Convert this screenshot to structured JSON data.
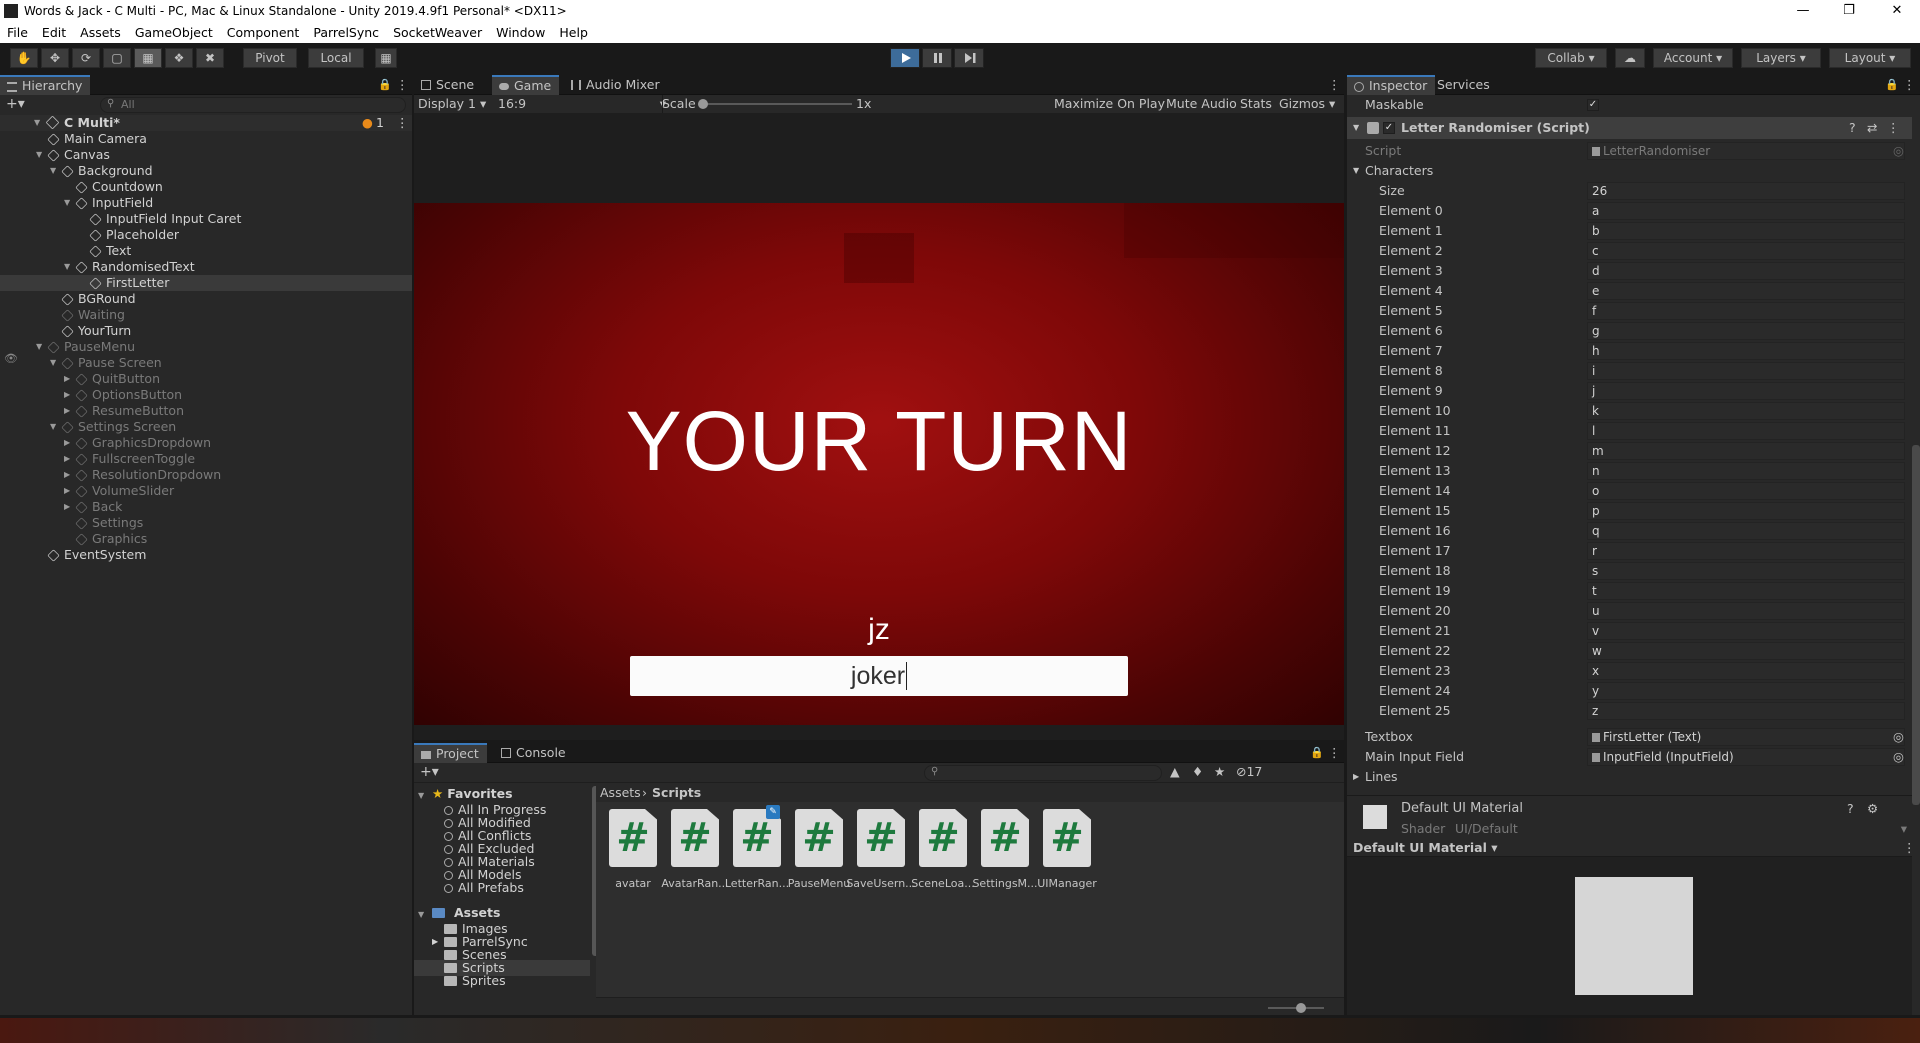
{
  "window": {
    "title": "Words & Jack - C Multi - PC, Mac & Linux Standalone - Unity 2019.4.9f1 Personal* <DX11>"
  },
  "menu": [
    "File",
    "Edit",
    "Assets",
    "GameObject",
    "Component",
    "ParrelSync",
    "SocketWeaver",
    "Window",
    "Help"
  ],
  "toolbar": {
    "pivot": "Pivot",
    "local": "Local",
    "collab": "Collab",
    "account": "Account",
    "layers": "Layers",
    "layout": "Layout"
  },
  "hierarchy": {
    "tab": "Hierarchy",
    "search_placeholder": "All",
    "scene": "C Multi*",
    "scene_count": "1",
    "items": [
      {
        "label": "Main Camera",
        "depth": 1,
        "dim": false,
        "sel": false,
        "arrow": ""
      },
      {
        "label": "Canvas",
        "depth": 1,
        "dim": false,
        "sel": false,
        "arrow": "▼"
      },
      {
        "label": "Background",
        "depth": 2,
        "dim": false,
        "sel": false,
        "arrow": "▼"
      },
      {
        "label": "Countdown",
        "depth": 3,
        "dim": false,
        "sel": false,
        "arrow": ""
      },
      {
        "label": "InputField",
        "depth": 3,
        "dim": false,
        "sel": false,
        "arrow": "▼"
      },
      {
        "label": "InputField Input Caret",
        "depth": 4,
        "dim": false,
        "sel": false,
        "arrow": ""
      },
      {
        "label": "Placeholder",
        "depth": 4,
        "dim": false,
        "sel": false,
        "arrow": ""
      },
      {
        "label": "Text",
        "depth": 4,
        "dim": false,
        "sel": false,
        "arrow": ""
      },
      {
        "label": "RandomisedText",
        "depth": 3,
        "dim": false,
        "sel": false,
        "arrow": "▼"
      },
      {
        "label": "FirstLetter",
        "depth": 4,
        "dim": false,
        "sel": true,
        "arrow": ""
      },
      {
        "label": "BGRound",
        "depth": 2,
        "dim": false,
        "sel": false,
        "arrow": ""
      },
      {
        "label": "Waiting",
        "depth": 2,
        "dim": true,
        "sel": false,
        "arrow": ""
      },
      {
        "label": "YourTurn",
        "depth": 2,
        "dim": false,
        "sel": false,
        "arrow": ""
      },
      {
        "label": "PauseMenu",
        "depth": 1,
        "dim": true,
        "sel": false,
        "arrow": "▼"
      },
      {
        "label": "Pause Screen",
        "depth": 2,
        "dim": true,
        "sel": false,
        "arrow": "▼"
      },
      {
        "label": "QuitButton",
        "depth": 3,
        "dim": true,
        "sel": false,
        "arrow": "▶"
      },
      {
        "label": "OptionsButton",
        "depth": 3,
        "dim": true,
        "sel": false,
        "arrow": "▶"
      },
      {
        "label": "ResumeButton",
        "depth": 3,
        "dim": true,
        "sel": false,
        "arrow": "▶"
      },
      {
        "label": "Settings Screen",
        "depth": 2,
        "dim": true,
        "sel": false,
        "arrow": "▼"
      },
      {
        "label": "GraphicsDropdown",
        "depth": 3,
        "dim": true,
        "sel": false,
        "arrow": "▶"
      },
      {
        "label": "FullscreenToggle",
        "depth": 3,
        "dim": true,
        "sel": false,
        "arrow": "▶"
      },
      {
        "label": "ResolutionDropdown",
        "depth": 3,
        "dim": true,
        "sel": false,
        "arrow": "▶"
      },
      {
        "label": "VolumeSlider",
        "depth": 3,
        "dim": true,
        "sel": false,
        "arrow": "▶"
      },
      {
        "label": "Back",
        "depth": 3,
        "dim": true,
        "sel": false,
        "arrow": "▶"
      },
      {
        "label": "Settings",
        "depth": 3,
        "dim": true,
        "sel": false,
        "arrow": ""
      },
      {
        "label": "Graphics",
        "depth": 3,
        "dim": true,
        "sel": false,
        "arrow": ""
      },
      {
        "label": "EventSystem",
        "depth": 1,
        "dim": false,
        "sel": false,
        "arrow": ""
      }
    ]
  },
  "views": {
    "scene_tab": "Scene",
    "game_tab": "Game",
    "audio_tab": "Audio Mixer",
    "display": "Display 1",
    "aspect": "16:9",
    "scale_label": "Scale",
    "scale_value": "1x",
    "maximize": "Maximize On Play",
    "mute": "Mute Audio",
    "stats": "Stats",
    "gizmos": "Gizmos"
  },
  "game": {
    "heading": "YOUR TURN",
    "letters": "jz",
    "input_value": "joker"
  },
  "project": {
    "tab": "Project",
    "console_tab": "Console",
    "hidden_count": "17",
    "favorites_label": "Favorites",
    "favorites": [
      "All In Progress",
      "All Modified",
      "All Conflicts",
      "All Excluded",
      "All Materials",
      "All Models",
      "All Prefabs"
    ],
    "assets_label": "Assets",
    "folders": [
      "Images",
      "ParrelSync",
      "Scenes",
      "Scripts",
      "Sprites"
    ],
    "breadcrumb": [
      "Assets",
      "Scripts"
    ],
    "files": [
      "avatar",
      "AvatarRan...",
      "LetterRan...",
      "PauseMenu",
      "SaveUsern...",
      "SceneLoa...",
      "SettingsM...",
      "UIManager"
    ]
  },
  "inspector": {
    "tab": "Inspector",
    "services_tab": "Services",
    "maskable_label": "Maskable",
    "component_title": "Letter Randomiser (Script)",
    "script_label": "Script",
    "script_value": "LetterRandomiser",
    "characters_label": "Characters",
    "size_label": "Size",
    "size_value": "26",
    "elements": [
      {
        "label": "Element 0",
        "value": "a"
      },
      {
        "label": "Element 1",
        "value": "b"
      },
      {
        "label": "Element 2",
        "value": "c"
      },
      {
        "label": "Element 3",
        "value": "d"
      },
      {
        "label": "Element 4",
        "value": "e"
      },
      {
        "label": "Element 5",
        "value": "f"
      },
      {
        "label": "Element 6",
        "value": "g"
      },
      {
        "label": "Element 7",
        "value": "h"
      },
      {
        "label": "Element 8",
        "value": "i"
      },
      {
        "label": "Element 9",
        "value": "j"
      },
      {
        "label": "Element 10",
        "value": "k"
      },
      {
        "label": "Element 11",
        "value": "l"
      },
      {
        "label": "Element 12",
        "value": "m"
      },
      {
        "label": "Element 13",
        "value": "n"
      },
      {
        "label": "Element 14",
        "value": "o"
      },
      {
        "label": "Element 15",
        "value": "p"
      },
      {
        "label": "Element 16",
        "value": "q"
      },
      {
        "label": "Element 17",
        "value": "r"
      },
      {
        "label": "Element 18",
        "value": "s"
      },
      {
        "label": "Element 19",
        "value": "t"
      },
      {
        "label": "Element 20",
        "value": "u"
      },
      {
        "label": "Element 21",
        "value": "v"
      },
      {
        "label": "Element 22",
        "value": "w"
      },
      {
        "label": "Element 23",
        "value": "x"
      },
      {
        "label": "Element 24",
        "value": "y"
      },
      {
        "label": "Element 25",
        "value": "z"
      }
    ],
    "textbox_label": "Textbox",
    "textbox_value": "FirstLetter (Text)",
    "main_input_label": "Main Input Field",
    "main_input_value": "InputField (InputField)",
    "lines_label": "Lines",
    "material_name": "Default UI Material",
    "shader_label": "Shader",
    "shader_value": "UI/Default",
    "preview_label": "Default UI Material"
  },
  "colors": {
    "accent": "#3a79bb",
    "play_active": "#3d6c9a",
    "script_icon": "#1e7a3e"
  }
}
